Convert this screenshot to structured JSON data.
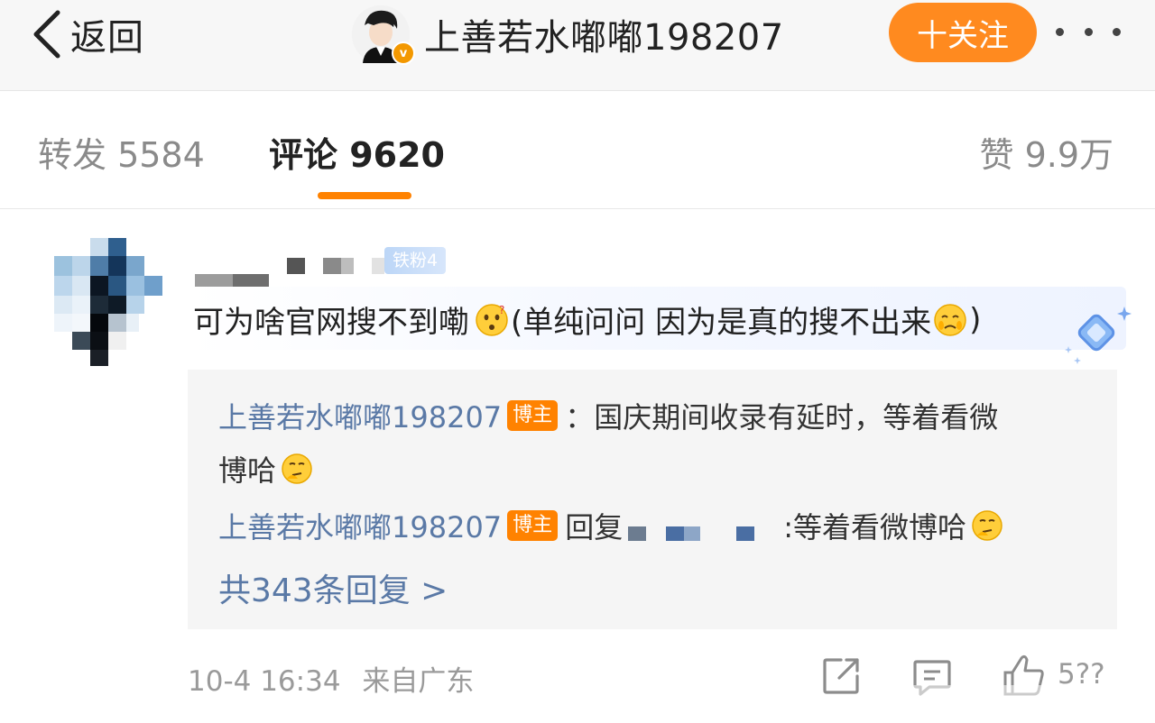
{
  "nav": {
    "back_label": "返回",
    "title": "上善若水嘟嘟198207",
    "verified_badge": "v",
    "follow_label": "十关注",
    "more_icon": "more-dots-icon"
  },
  "tabs": {
    "repost": "转发 5584",
    "comment": "评论 9620",
    "like": "赞 9.9万"
  },
  "comment": {
    "fan_badge": "铁粉4",
    "text_before": "可为啥官网搜不到嘞",
    "text_after": "(单纯问问 因为是真的搜不出来",
    "text_close": ")",
    "replies": [
      {
        "user": "上善若水嘟嘟198207",
        "badge": "博主",
        "text_line1": "：国庆期间收录有延时，等着看微",
        "text_line2": "博哈"
      },
      {
        "user": "上善若水嘟嘟198207",
        "badge": "博主",
        "reply_word": "回复",
        "text": ":等着看微博哈"
      }
    ],
    "reply_count": "共343条回复 >",
    "time": "10-4 16:34",
    "location": "来自广东",
    "like_count": "5??"
  },
  "colors": {
    "accent": "#ff8200",
    "link": "#5a79a6"
  }
}
